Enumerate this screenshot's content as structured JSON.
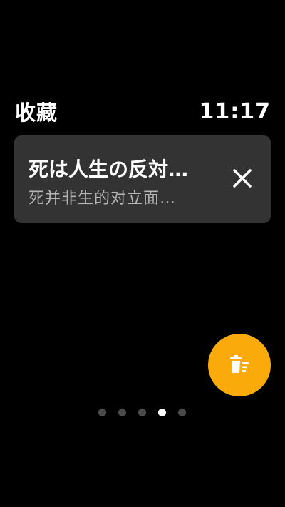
{
  "header": {
    "title": "收藏",
    "time": "11:17"
  },
  "favorite_item": {
    "title": "死は人生の反対…",
    "subtitle": "死并非生的对立面…",
    "remove_icon": "close-icon"
  },
  "fab": {
    "icon": "clear-list-icon",
    "color": "#FBAA0C"
  },
  "pagination": {
    "total": 5,
    "active_index": 3
  }
}
